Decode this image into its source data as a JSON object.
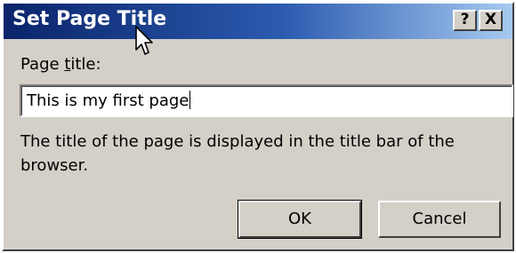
{
  "dialog": {
    "title": "Set Page Title",
    "help_button": "?",
    "close_button": "X"
  },
  "form": {
    "label_prefix": "Page ",
    "label_accel": "t",
    "label_suffix": "itle:",
    "input_value": "This is my first page",
    "description": "The title of the page is displayed in the title bar of the browser."
  },
  "buttons": {
    "ok": "OK",
    "cancel": "Cancel"
  },
  "colors": {
    "title_bar_start": "#0a246a",
    "title_bar_end": "#a6caf0",
    "face": "#d4d0c8"
  }
}
